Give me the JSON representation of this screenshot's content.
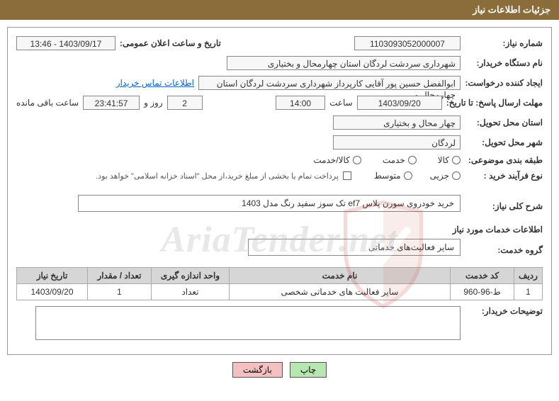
{
  "header": {
    "title": "جزئیات اطلاعات نیاز"
  },
  "fields": {
    "needNumber_label": "شماره نیاز:",
    "needNumber": "1103093052000007",
    "announceDate_label": "تاریخ و ساعت اعلان عمومی:",
    "announceDate": "1403/09/17 - 13:46",
    "buyerOrg_label": "نام دستگاه خریدار:",
    "buyerOrg": "شهرداری سردشت لردگان استان چهارمحال و بختیاری",
    "requester_label": "ایجاد کننده درخواست:",
    "requester": "ابوالفضل حسین پور آقایی کارپرداز شهرداری سردشت لردگان استان چهارمحال و",
    "requester_link": "اطلاعات تماس خریدار",
    "deadline_label": "مهلت ارسال پاسخ: تا تاریخ:",
    "deadlineDate": "1403/09/20",
    "time_label": "ساعت",
    "deadlineTime": "14:00",
    "remainDays": "2",
    "days_and": "روز و",
    "remainTime": "23:41:57",
    "remain_label": "ساعت باقی مانده",
    "deliveryProvince_label": "استان محل تحویل:",
    "deliveryProvince": "چهار محال و بختیاری",
    "deliveryCity_label": "شهر محل تحویل:",
    "deliveryCity": "لردگان",
    "category_label": "طبقه بندی موضوعی:",
    "cat_opt1": "کالا",
    "cat_opt2": "خدمت",
    "cat_opt3": "کالا/خدمت",
    "buyType_label": "نوع فرآیند خرید :",
    "buy_opt1": "جزیی",
    "buy_opt2": "متوسط",
    "treasury_note": "پرداخت تمام یا بخشی از مبلغ خرید،از محل \"اسناد خزانه اسلامی\" خواهد بود.",
    "needDesc_label": "شرح کلی نیاز:",
    "needDesc": "خرید خودروی سورن پلاس ef7 تک سوز سفید رنگ مدل 1403",
    "servicesInfo_label": "اطلاعات خدمات مورد نیاز",
    "serviceGroup_label": "گروه خدمت:",
    "serviceGroup": "سایر فعالیت‌های خدماتی",
    "buyerNotes_label": "توضیحات خریدار:"
  },
  "table": {
    "headers": {
      "row": "ردیف",
      "code": "کد خدمت",
      "name": "نام خدمت",
      "unit": "واحد اندازه گیری",
      "qty": "تعداد / مقدار",
      "date": "تاریخ نیاز"
    },
    "rows": [
      {
        "row": "1",
        "code": "ط-96-960",
        "name": "سایر فعالیت های خدماتی شخصی",
        "unit": "تعداد",
        "qty": "1",
        "date": "1403/09/20"
      }
    ]
  },
  "buttons": {
    "print": "چاپ",
    "back": "بازگشت"
  },
  "watermark": "AriaTender.net"
}
